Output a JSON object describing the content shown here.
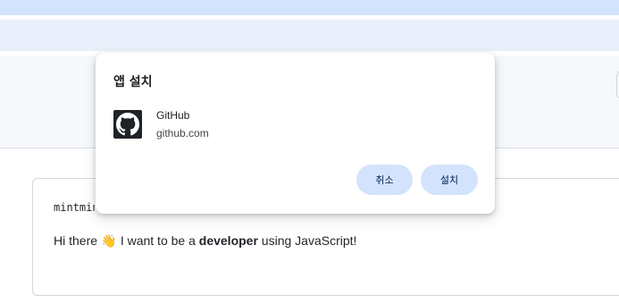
{
  "dialog": {
    "title": "앱 설치",
    "app": {
      "name": "GitHub",
      "url": "github.com",
      "icon": "github-icon"
    },
    "buttons": {
      "cancel": "취소",
      "install": "설치"
    }
  },
  "readme": {
    "title": "mintmin",
    "line_prefix": "Hi there",
    "emoji": "👋",
    "line_middle": "I want to be a",
    "line_bold": "developer",
    "line_suffix": "using JavaScript!"
  },
  "colors": {
    "tabstrip": "#d3e3fd",
    "toolbar": "#e9effa",
    "button_bg": "#d3e3fd",
    "button_text": "#041e49"
  }
}
